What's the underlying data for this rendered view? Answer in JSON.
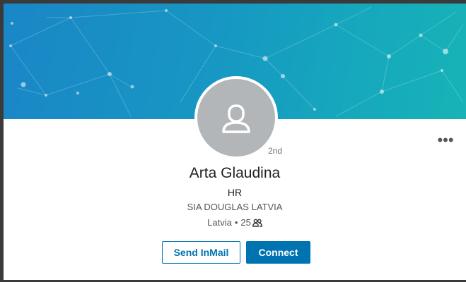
{
  "profile": {
    "degree": "2nd",
    "name": "Arta Glaudina",
    "headline": "HR",
    "company": "SIA DOUGLAS LATVIA",
    "location": "Latvia",
    "separator": "•",
    "connections": "25"
  },
  "actions": {
    "more_label": "•••",
    "inmail_label": "Send InMail",
    "connect_label": "Connect"
  },
  "colors": {
    "brand": "#0073b1",
    "banner_start": "#1a86c6",
    "banner_end": "#17b3b7",
    "avatar_bg": "#b3b6b9"
  },
  "icons": {
    "avatar": "person-placeholder-icon",
    "connections": "people-icon",
    "more": "more-dots-icon"
  }
}
